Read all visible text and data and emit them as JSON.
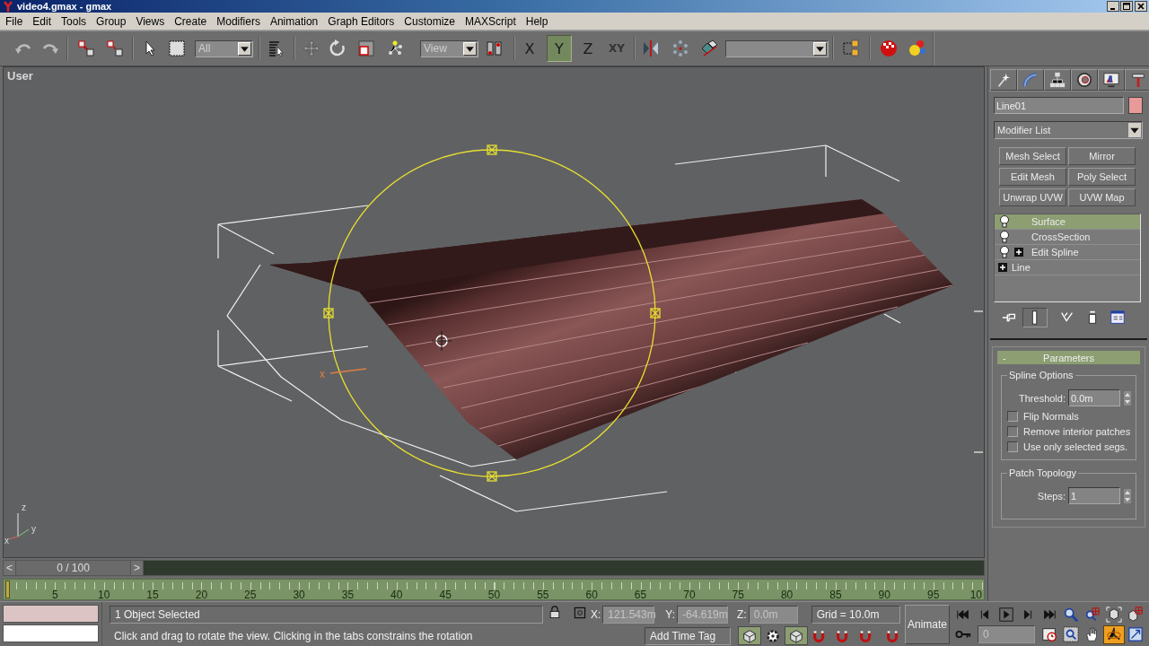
{
  "window": {
    "title": "video4.gmax - gmax"
  },
  "menu": [
    "File",
    "Edit",
    "Tools",
    "Group",
    "Views",
    "Create",
    "Modifiers",
    "Animation",
    "Graph Editors",
    "Customize",
    "MAXScript",
    "Help"
  ],
  "toolbar": {
    "selection_filter": "All",
    "reference_coordinate_system": "View",
    "axis_constraints": [
      {
        "label": "X",
        "selected": false
      },
      {
        "label": "Y",
        "selected": true
      },
      {
        "label": "Z",
        "selected": false
      },
      {
        "label": "XY",
        "selected": false
      }
    ]
  },
  "viewport": {
    "label": "User",
    "pivot_axis_label": "x",
    "tripod_labels": [
      "z",
      "y",
      "x"
    ]
  },
  "command_panel": {
    "object_name": "Line01",
    "modifier_list": "Modifier List",
    "modifier_buttons": [
      "Mesh Select",
      "Mirror",
      "Edit Mesh",
      "Poly Select",
      "Unwrap UVW",
      "UVW Map"
    ],
    "stack": [
      {
        "label": "Surface",
        "kind": "modifier",
        "expandable": false,
        "selected": true
      },
      {
        "label": "CrossSection",
        "kind": "modifier",
        "expandable": false,
        "selected": false
      },
      {
        "label": "Edit Spline",
        "kind": "modifier",
        "expandable": true,
        "selected": false
      },
      {
        "label": "Line",
        "kind": "object",
        "expandable": true,
        "selected": false
      }
    ],
    "stack_tools": [
      {
        "on": false
      },
      {
        "on": true
      },
      {
        "on": false
      },
      {
        "on": false
      },
      {
        "on": false
      }
    ],
    "rollout": {
      "collapse_sign": "-",
      "title": "Parameters",
      "spline_options": {
        "title": "Spline Options",
        "threshold_label": "Threshold:",
        "threshold_value": "0.0m",
        "checkboxes": [
          {
            "label": "Flip Normals",
            "checked": false
          },
          {
            "label": "Remove interior patches",
            "checked": false
          },
          {
            "label": "Use only selected segs.",
            "checked": false
          }
        ]
      },
      "patch_topology": {
        "title": "Patch Topology",
        "steps_label": "Steps:",
        "steps_value": "1"
      }
    }
  },
  "time_slider": {
    "prev": "<",
    "label": "0 / 100",
    "next": ">",
    "level": 0
  },
  "track_bar": {
    "labels": [
      "5",
      "10",
      "15",
      "20",
      "25",
      "30",
      "35",
      "40",
      "45",
      "50",
      "55",
      "60",
      "65",
      "70",
      "75",
      "80",
      "85",
      "90",
      "95",
      "10"
    ]
  },
  "status": {
    "selection": "1 Object Selected",
    "prompt": "Click and drag to rotate the view.  Clicking in the tabs constrains the rotation",
    "coordinates": [
      {
        "label": "X:",
        "value": "121.543m"
      },
      {
        "label": "Y:",
        "value": "-64.619m"
      },
      {
        "label": "Z:",
        "value": "0.0m"
      }
    ],
    "grid": "Grid = 10.0m",
    "add_time_tag": "Add Time Tag",
    "animate": "Animate",
    "frame": "0",
    "mode_buttons": [
      {
        "on": true
      },
      {
        "on": false
      },
      {
        "on": true
      }
    ],
    "viewport_navigation": [
      {
        "selected": false
      },
      {
        "selected": false
      },
      {
        "selected": false
      },
      {
        "selected": false
      },
      {
        "selected": false
      },
      {
        "selected": false
      },
      {
        "selected": true
      },
      {
        "selected": false
      }
    ]
  }
}
